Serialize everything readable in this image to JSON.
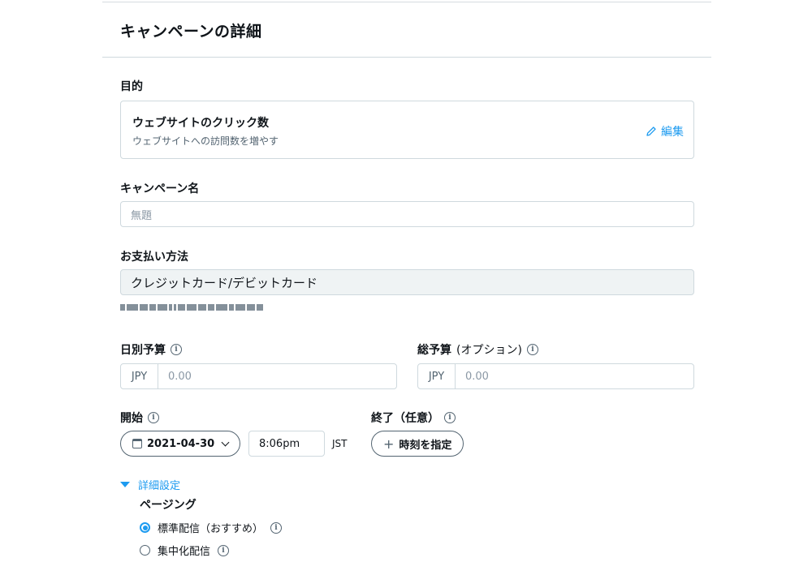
{
  "header": {
    "title": "キャンペーンの詳細"
  },
  "objective": {
    "label": "目的",
    "title": "ウェブサイトのクリック数",
    "description": "ウェブサイトへの訪問数を増やす",
    "edit_label": "編集"
  },
  "campaign_name": {
    "label": "キャンペーン名",
    "placeholder": "無題"
  },
  "payment": {
    "label": "お支払い方法",
    "value": "クレジットカード/デビットカード"
  },
  "daily_budget": {
    "label": "日別予算",
    "currency": "JPY",
    "placeholder": "0.00"
  },
  "total_budget": {
    "label": "総予算",
    "optional": "(オプション)",
    "currency": "JPY",
    "placeholder": "0.00"
  },
  "start": {
    "label": "開始",
    "date": "2021-04-30",
    "time": "8:06pm",
    "timezone": "JST"
  },
  "end": {
    "label": "終了（任意）",
    "button_label": "時刻を指定"
  },
  "advanced": {
    "toggle_label": "詳細設定",
    "pacing_label": "ページング",
    "options": [
      {
        "label": "標準配信（おすすめ）",
        "selected": true
      },
      {
        "label": "集中化配信",
        "selected": false
      }
    ]
  },
  "colors": {
    "accent": "#1d9bf0",
    "border": "#cfd9de",
    "text": "#0f1419",
    "muted": "#536471"
  },
  "icons": [
    "pencil-icon",
    "info-icon",
    "calendar-icon",
    "chevron-down-icon",
    "plus-icon",
    "triangle-down-icon"
  ]
}
